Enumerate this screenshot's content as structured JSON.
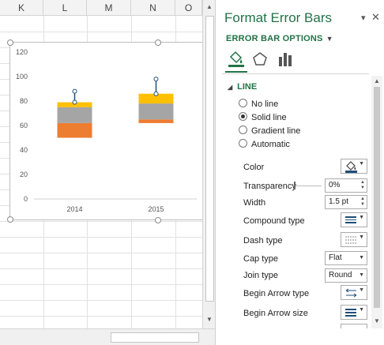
{
  "sheet": {
    "columns": [
      "K",
      "L",
      "M",
      "N",
      "O"
    ],
    "chart": {
      "chart_data": {
        "type": "bar",
        "stacked": true,
        "categories": [
          "2014",
          "2015"
        ],
        "series": [
          {
            "values": [
              50,
              62
            ],
            "color": "#ffffff"
          },
          {
            "values": [
              12,
              3
            ],
            "color": "#ed7d31"
          },
          {
            "values": [
              13,
              13
            ],
            "color": "#a5a5a5"
          },
          {
            "values": [
              4,
              8
            ],
            "color": "#ffc000"
          }
        ],
        "error_bars": [
          {
            "category": "2014",
            "from": 79,
            "to": 88
          },
          {
            "category": "2015",
            "from": 86,
            "to": 98
          }
        ],
        "ylim": [
          0,
          120
        ],
        "yticks": [
          "0",
          "20",
          "40",
          "60",
          "80",
          "100",
          "120"
        ],
        "grid": false,
        "error_bar_color": "#1f4e79"
      }
    }
  },
  "pane": {
    "title": "Format Error Bars",
    "close_icon": "close-icon",
    "dropdown_icon": "chevron-down-icon",
    "options_label": "ERROR BAR OPTIONS",
    "tabs": [
      {
        "icon": "fill-line-icon",
        "selected": true
      },
      {
        "icon": "effects-pentagon-icon",
        "selected": false
      },
      {
        "icon": "bar-chart-options-icon",
        "selected": false
      }
    ],
    "section": "LINE",
    "radios": [
      "No line",
      "Solid line",
      "Gradient line",
      "Automatic"
    ],
    "selected_radio": "Solid line",
    "props": {
      "color": "Color",
      "transparency": "Transparency",
      "transparency_value": "0%",
      "width": "Width",
      "width_value": "1.5 pt",
      "compound": "Compound type",
      "dash": "Dash type",
      "cap": "Cap type",
      "cap_value": "Flat",
      "join": "Join type",
      "join_value": "Round",
      "begin_arrow_type": "Begin Arrow type",
      "begin_arrow_size": "Begin Arrow size"
    },
    "accent_color": "#217346"
  }
}
